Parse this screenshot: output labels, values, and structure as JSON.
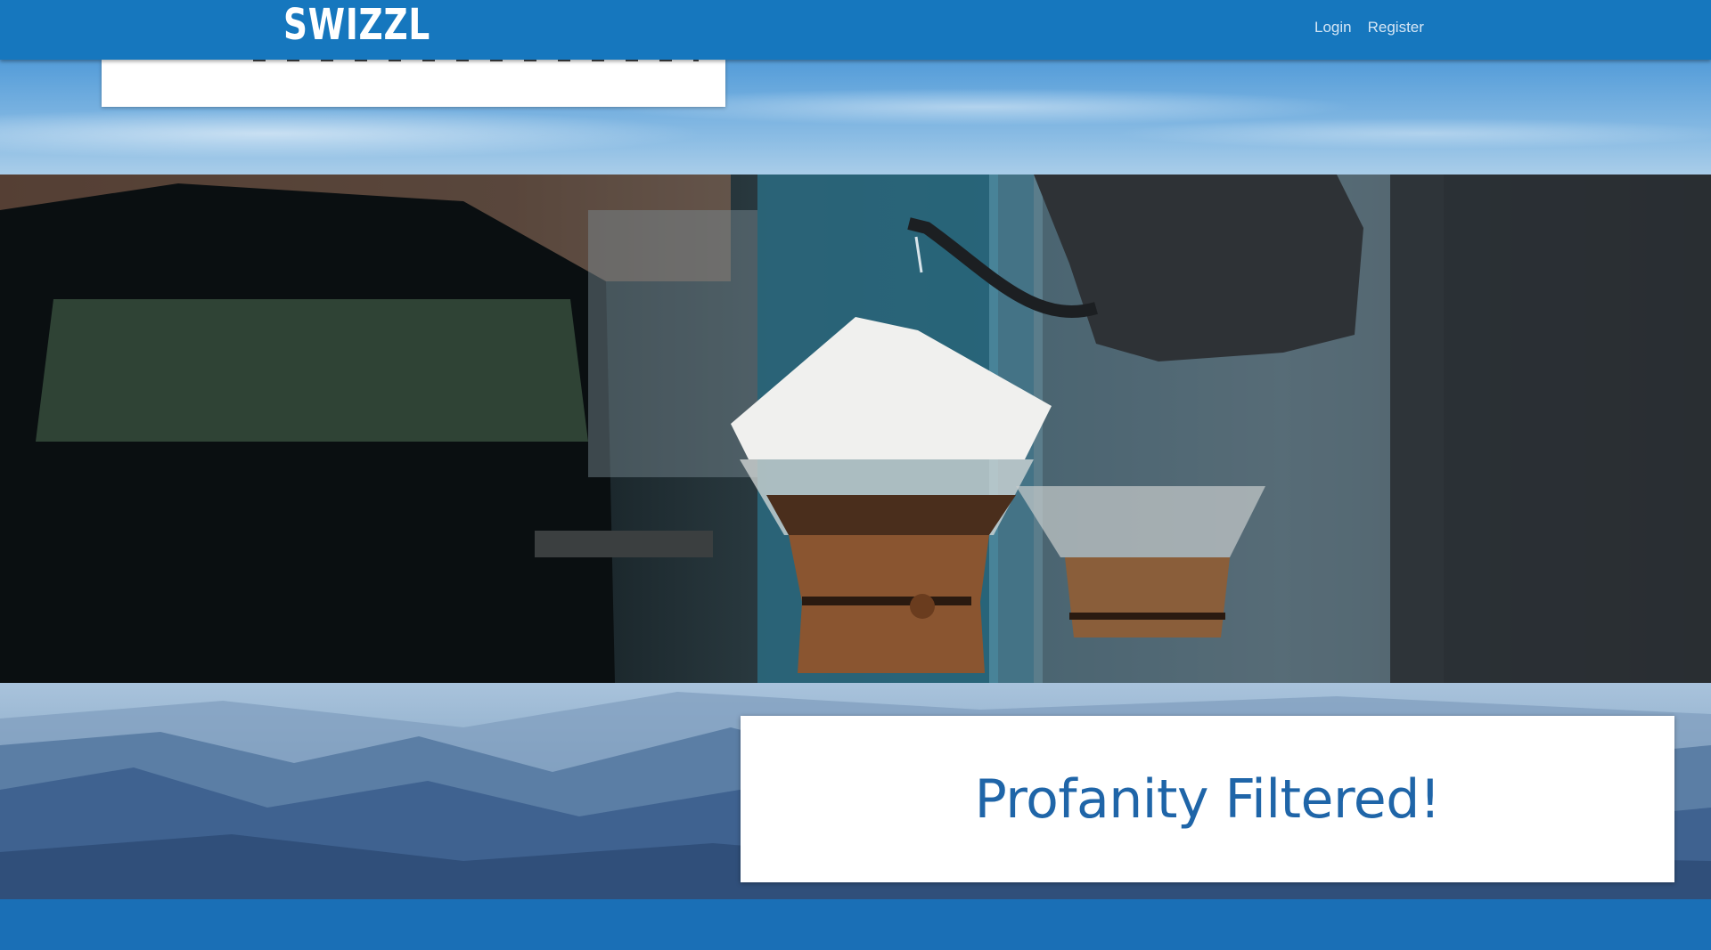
{
  "navbar": {
    "brand": "SWIZZL",
    "links": [
      {
        "label": "Login"
      },
      {
        "label": "Register"
      }
    ],
    "color": "#1677be"
  },
  "hero": {
    "headline": "Profanity Filtered!",
    "headline_color": "#1f65a8"
  },
  "images": [
    {
      "name": "sky-background"
    },
    {
      "name": "coffee-pour-over-photo"
    },
    {
      "name": "mountain-range-background"
    }
  ]
}
